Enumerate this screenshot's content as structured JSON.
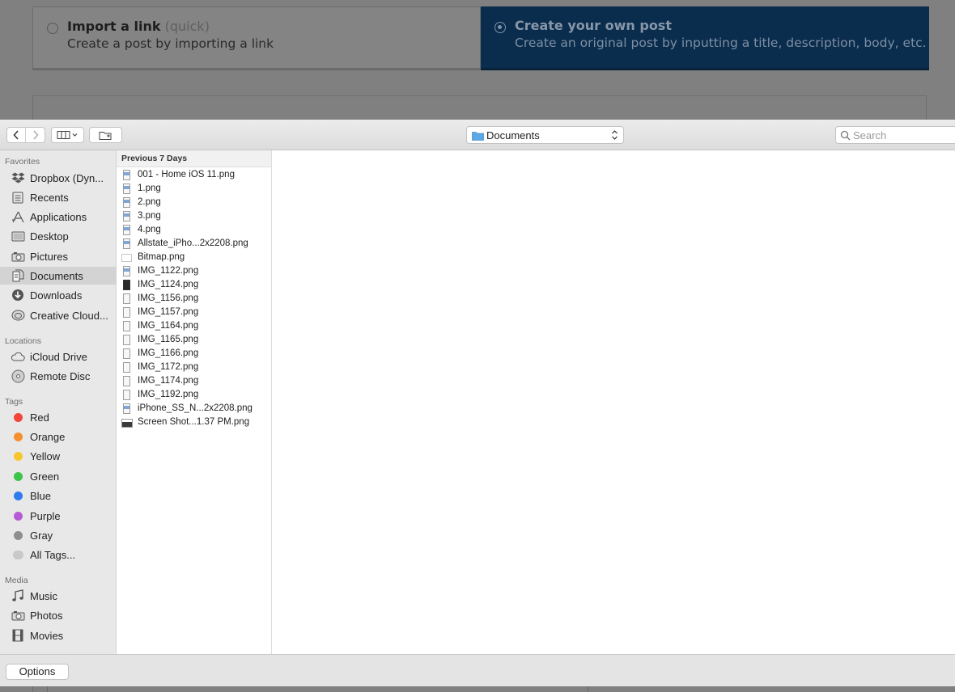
{
  "background_page": {
    "import_option": {
      "title": "Import a link",
      "hint": "(quick)",
      "description": "Create a post by importing a link"
    },
    "create_option": {
      "title": "Create your own post",
      "description": "Create an original post by inputting a title, description, body, etc."
    }
  },
  "toolbar": {
    "location": "Documents",
    "search_placeholder": "Search"
  },
  "sidebar": {
    "favorites_header": "Favorites",
    "favorites": [
      {
        "label": "Dropbox (Dyn...",
        "icon": "dropbox-icon"
      },
      {
        "label": "Recents",
        "icon": "recents-icon"
      },
      {
        "label": "Applications",
        "icon": "applications-icon"
      },
      {
        "label": "Desktop",
        "icon": "desktop-icon"
      },
      {
        "label": "Pictures",
        "icon": "camera-icon"
      },
      {
        "label": "Documents",
        "icon": "documents-icon"
      },
      {
        "label": "Downloads",
        "icon": "downloads-icon"
      },
      {
        "label": "Creative Cloud...",
        "icon": "creative-cloud-icon"
      }
    ],
    "locations_header": "Locations",
    "locations": [
      {
        "label": "iCloud Drive",
        "icon": "cloud-icon"
      },
      {
        "label": "Remote Disc",
        "icon": "disc-icon"
      }
    ],
    "tags_header": "Tags",
    "tags": [
      {
        "label": "Red",
        "color": "#f2463c"
      },
      {
        "label": "Orange",
        "color": "#f5902e"
      },
      {
        "label": "Yellow",
        "color": "#f7c62e"
      },
      {
        "label": "Green",
        "color": "#3ec34b"
      },
      {
        "label": "Blue",
        "color": "#2f7cf0"
      },
      {
        "label": "Purple",
        "color": "#b65bd6"
      },
      {
        "label": "Gray",
        "color": "#8e8e8e"
      },
      {
        "label": "All Tags...",
        "color": "#c9c9c9"
      }
    ],
    "media_header": "Media",
    "media": [
      {
        "label": "Music",
        "icon": "music-icon"
      },
      {
        "label": "Photos",
        "icon": "camera-icon"
      },
      {
        "label": "Movies",
        "icon": "film-icon"
      }
    ]
  },
  "file_column": {
    "header": "Previous 7 Days",
    "files": [
      "001 - Home iOS 11.png",
      "1.png",
      "2.png",
      "3.png",
      "4.png",
      "Allstate_iPho...2x2208.png",
      "Bitmap.png",
      "IMG_1122.png",
      "IMG_1124.png",
      "IMG_1156.png",
      "IMG_1157.png",
      "IMG_1164.png",
      "IMG_1165.png",
      "IMG_1166.png",
      "IMG_1172.png",
      "IMG_1174.png",
      "IMG_1192.png",
      "iPhone_SS_N...2x2208.png",
      "Screen Shot...1.37 PM.png"
    ]
  },
  "footer": {
    "options_label": "Options"
  }
}
